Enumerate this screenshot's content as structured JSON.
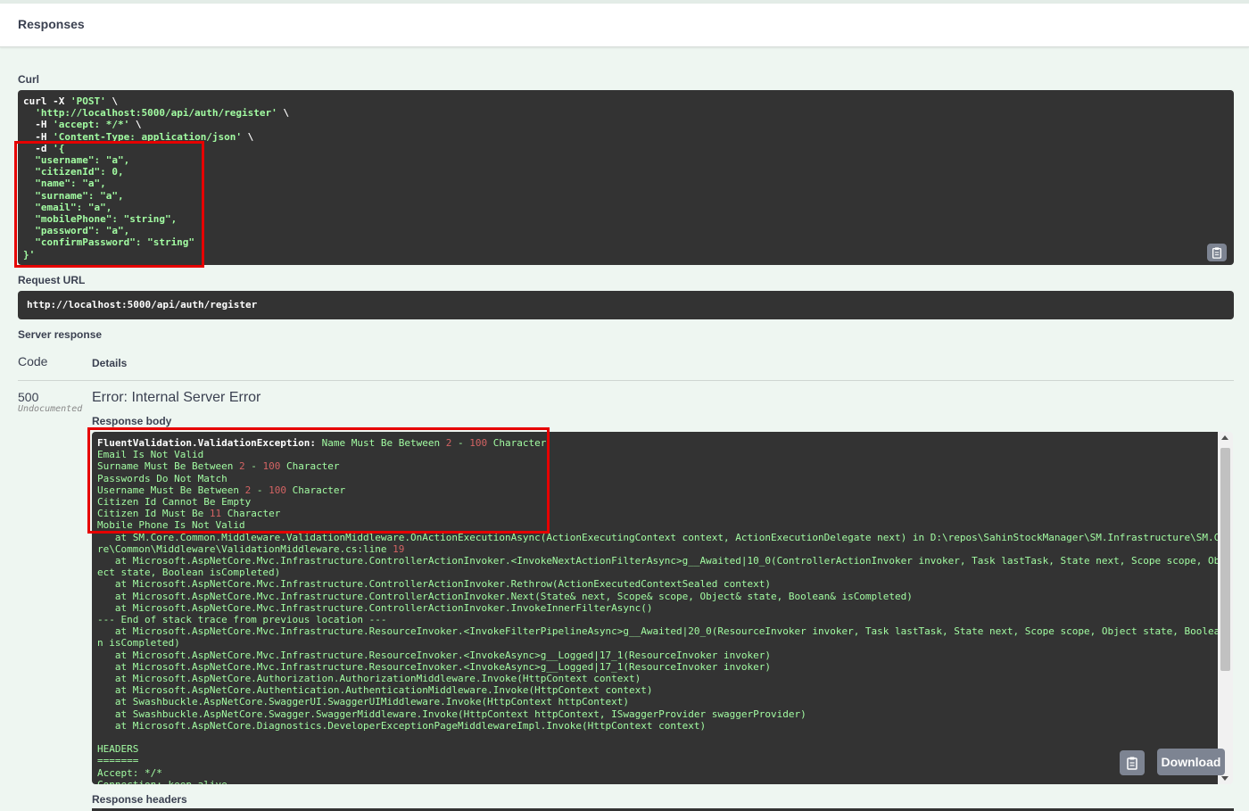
{
  "responses": {
    "title": "Responses"
  },
  "curl": {
    "label": "Curl",
    "copy_icon": "clipboard-icon"
  },
  "request_url": {
    "label": "Request URL",
    "value": "http://localhost:5000/api/auth/register"
  },
  "server_response": {
    "label": "Server response",
    "code_header": "Code",
    "details_header": "Details",
    "status_code": "500",
    "status_note": "Undocumented",
    "error_title": "Error: Internal Server Error",
    "response_body_label": "Response body",
    "download_label": "Download",
    "response_headers_label": "Response headers"
  },
  "colors": {
    "code_bg": "#333333",
    "string": "#a2fca2",
    "number": "#d36363",
    "highlight": "#e60000",
    "button": "#7d8492"
  }
}
